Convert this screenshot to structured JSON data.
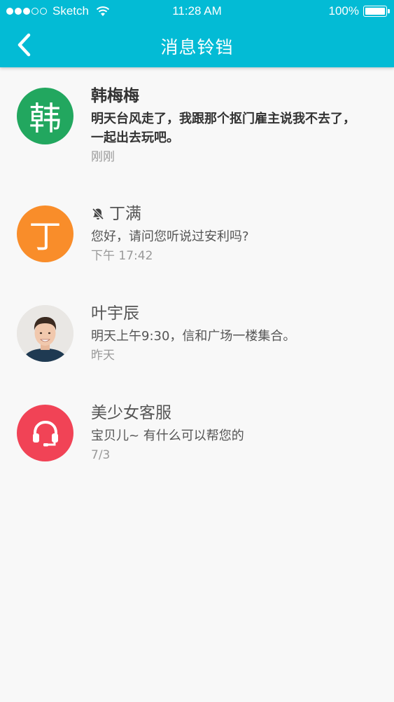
{
  "status_bar": {
    "carrier": "Sketch",
    "time": "11:28 AM",
    "battery": "100%"
  },
  "navbar": {
    "title": "消息铃铛",
    "back_icon": "chevron-left-icon"
  },
  "messages": [
    {
      "avatar_text": "韩",
      "avatar_color": "#22a75f",
      "name": "韩梅梅",
      "text": "明天台风走了，我跟那个抠门雇主说我不去了，一起出去玩吧。",
      "time": "刚刚",
      "unread": true,
      "muted": false
    },
    {
      "avatar_text": "丁",
      "avatar_color": "#f98d2a",
      "name": "丁满",
      "text": "您好，请问您听说过安利吗?",
      "time": "下午 17:42",
      "unread": false,
      "muted": true
    },
    {
      "avatar_type": "photo",
      "name": "叶宇辰",
      "text": "明天上午9:30，信和广场一楼集合。",
      "time": "昨天",
      "unread": false,
      "muted": false
    },
    {
      "avatar_icon": "headset-icon",
      "avatar_color": "#f14356",
      "name": "美少女客服",
      "text": "宝贝儿~ 有什么可以帮您的",
      "time": "7/3",
      "unread": false,
      "muted": false
    }
  ]
}
